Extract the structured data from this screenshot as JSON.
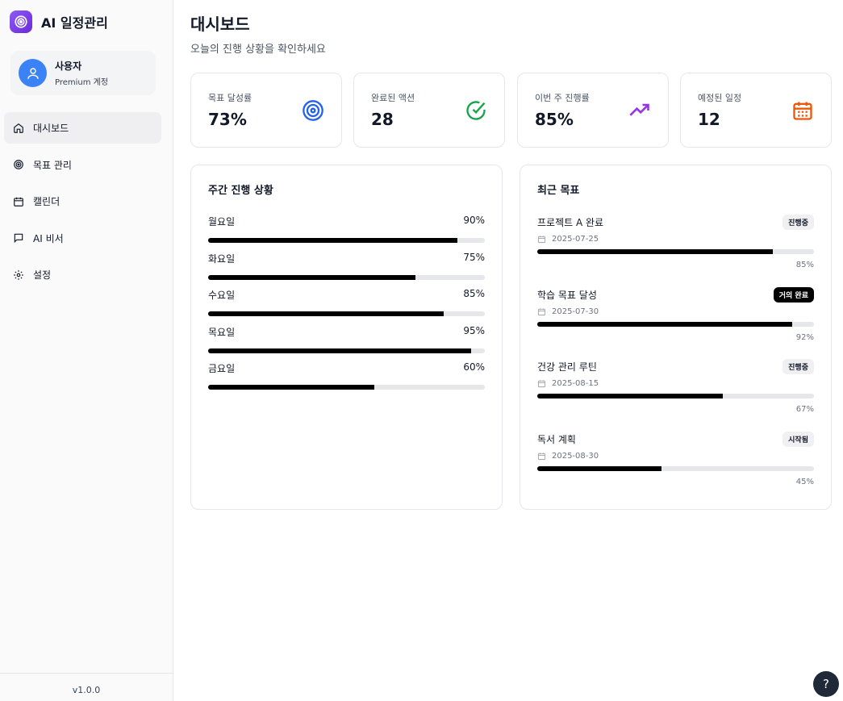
{
  "app": {
    "name": "AI 일정관리",
    "version": "v1.0.0"
  },
  "user": {
    "name": "사용자",
    "plan": "Premium 계정"
  },
  "nav": [
    {
      "label": "대시보드",
      "icon": "home-icon",
      "active": true
    },
    {
      "label": "목표 관리",
      "icon": "target-icon"
    },
    {
      "label": "캘린더",
      "icon": "calendar-icon"
    },
    {
      "label": "AI 비서",
      "icon": "chat-icon"
    },
    {
      "label": "설정",
      "icon": "gear-icon"
    }
  ],
  "page": {
    "title": "대시보드",
    "subtitle": "오늘의 진행 상황을 확인하세요"
  },
  "stats": [
    {
      "label": "목표 달성률",
      "value": "73%",
      "icon": "target-icon",
      "color": "#2563eb"
    },
    {
      "label": "완료된 액션",
      "value": "28",
      "icon": "check-circle-icon",
      "color": "#16a34a"
    },
    {
      "label": "이번 주 진행률",
      "value": "85%",
      "icon": "trending-up-icon",
      "color": "#9333ea"
    },
    {
      "label": "예정된 일정",
      "value": "12",
      "icon": "calendar-icon",
      "color": "#ea580c"
    }
  ],
  "weekly": {
    "title": "주간 진행 상황",
    "days": [
      {
        "label": "월요일",
        "pct_text": "90%",
        "pct": 90
      },
      {
        "label": "화요일",
        "pct_text": "75%",
        "pct": 75
      },
      {
        "label": "수요일",
        "pct_text": "85%",
        "pct": 85
      },
      {
        "label": "목요일",
        "pct_text": "95%",
        "pct": 95
      },
      {
        "label": "금요일",
        "pct_text": "60%",
        "pct": 60
      }
    ]
  },
  "recent": {
    "title": "최근 목표",
    "goals": [
      {
        "title": "프로젝트 A 완료",
        "status": "진행중",
        "date": "2025-07-25",
        "pct_text": "85%",
        "pct": 85,
        "dark": false
      },
      {
        "title": "학습 목표 달성",
        "status": "거의 완료",
        "date": "2025-07-30",
        "pct_text": "92%",
        "pct": 92,
        "dark": true
      },
      {
        "title": "건강 관리 루틴",
        "status": "진행중",
        "date": "2025-08-15",
        "pct_text": "67%",
        "pct": 67,
        "dark": false
      },
      {
        "title": "독서 계획",
        "status": "시작됨",
        "date": "2025-08-30",
        "pct_text": "45%",
        "pct": 45,
        "dark": false
      }
    ]
  },
  "help": {
    "label": "?"
  }
}
